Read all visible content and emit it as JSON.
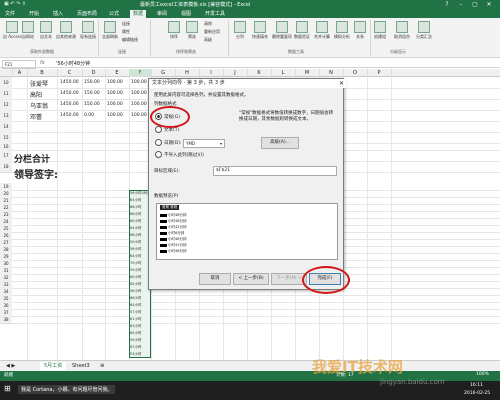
{
  "window": {
    "title": "最新员工excel工资表模板.xls [兼容模式] - Excel",
    "quick_access": "▣ ↶ ↷ ⇧",
    "controls": [
      "?",
      "–",
      "▢",
      "✕"
    ]
  },
  "menu_tabs": [
    "文件",
    "开始",
    "插入",
    "页面布局",
    "公式",
    "数据",
    "审阅",
    "视图",
    "开发工具"
  ],
  "active_tab": "数据",
  "ribbon": {
    "buttons": [
      "自 Access",
      "自网站",
      "自文本",
      "自其他来源",
      "现有连接",
      "全部刷新",
      "连接",
      "属性",
      "编辑链接",
      "排序",
      "筛选",
      "清除",
      "重新应用",
      "高级",
      "分列",
      "快速填充",
      "删除重复项",
      "数据验证",
      "合并计算",
      "模拟分析",
      "关系",
      "创建组",
      "取消组合",
      "分类汇总"
    ],
    "groups": [
      "获取外部数据",
      "连接",
      "排序和筛选",
      "数据工具",
      "分级显示"
    ]
  },
  "formula_bar": {
    "name_box": "F21",
    "fx": "fx",
    "value": "'56小时48分钟"
  },
  "columns": [
    "A",
    "B",
    "C",
    "D",
    "E",
    "F",
    "G",
    "H",
    "I",
    "J",
    "K",
    "L",
    "M",
    "N",
    "O",
    "P"
  ],
  "selected_column": "F",
  "rows": [
    "10",
    "11",
    "12",
    "13",
    "14",
    "15",
    "16",
    "17",
    "18",
    "19",
    "20",
    "21",
    "22",
    "23",
    "24",
    "25",
    "26",
    "27",
    "28",
    "29",
    "30",
    "31",
    "32",
    "33",
    "34",
    "35",
    "36",
    "37",
    "38"
  ],
  "table_rows": [
    {
      "name": "张爱琴",
      "values": [
        "1450.00",
        "150.00",
        "100.00",
        "100.00"
      ]
    },
    {
      "name": "高阳",
      "values": [
        "1450.00",
        "150.00",
        "100.00",
        "100.00"
      ]
    },
    {
      "name": "乌亚翁",
      "values": [
        "1450.00",
        "150.00",
        "100.00",
        "100.00"
      ]
    },
    {
      "name": "邓蕾",
      "values": [
        "1450.00",
        "0.00",
        "100.00",
        "100.00"
      ]
    }
  ],
  "subtotal_label": "分栏合计",
  "signature_label": "领导签字:",
  "col_f_values": [
    "56小时48分",
    "64小时",
    "68小时",
    "66小时",
    "60小时",
    "64小时",
    "68小时",
    "50小时",
    "56小时",
    "64小时",
    "70小时",
    "55小时",
    "60小时",
    "62小时",
    "58小时",
    "66小时",
    "64小时",
    "57小时",
    "61小时",
    "63小时",
    "65小时",
    "59小时",
    "67小时",
    "53小时"
  ],
  "dialog": {
    "title": "文本分列向导 - 第 3 步，共 3 步",
    "close": "✕",
    "instruction": "使用此屏内容可选择各列，并设置其数据格式。",
    "group_label": "列数据格式",
    "options": [
      "常规(G)",
      "文本(T)",
      "日期(D):",
      "不导入此列(跳过)(I)"
    ],
    "selected_option": "常规(G)",
    "date_format": "YMD",
    "description": "\"常规\"数据格式将数值转换成数字，日期值会转换成日期，其余数据则转换成文本。",
    "advanced_button": "高级(A)...",
    "dest_label": "目标区域(E):",
    "dest_value": "$F$21",
    "preview_label": "数据预览(P)",
    "preview_header": "常规  常规",
    "preview_rows": [
      "小时48分钟",
      "小时48分钟",
      "小时42分钟",
      "小时6分钟",
      "小时48分钟",
      "小时41分钟",
      "小时48分钟"
    ],
    "buttons": {
      "cancel": "取消",
      "back": "< 上一步(B)",
      "next": "下一步(N) >",
      "finish": "完成(F)"
    }
  },
  "sheet_tabs": [
    "5月工资",
    "Sheet3"
  ],
  "active_sheet": "5月工资",
  "status": {
    "ready": "就绪",
    "count_label": "计数: 17",
    "zoom": "100%"
  },
  "taskbar": {
    "cortana": "我是 Cortana，小娜。有问题尽管问我。",
    "time": "16:11",
    "date": "2016-02-25"
  },
  "watermark": {
    "logo": "我爱IT技术网",
    "url": "jingyan.baidu.com"
  },
  "colors": {
    "excel_green": "#217346",
    "annotation_red": "#d0161b",
    "selection_fill": "#eaf4ee"
  }
}
